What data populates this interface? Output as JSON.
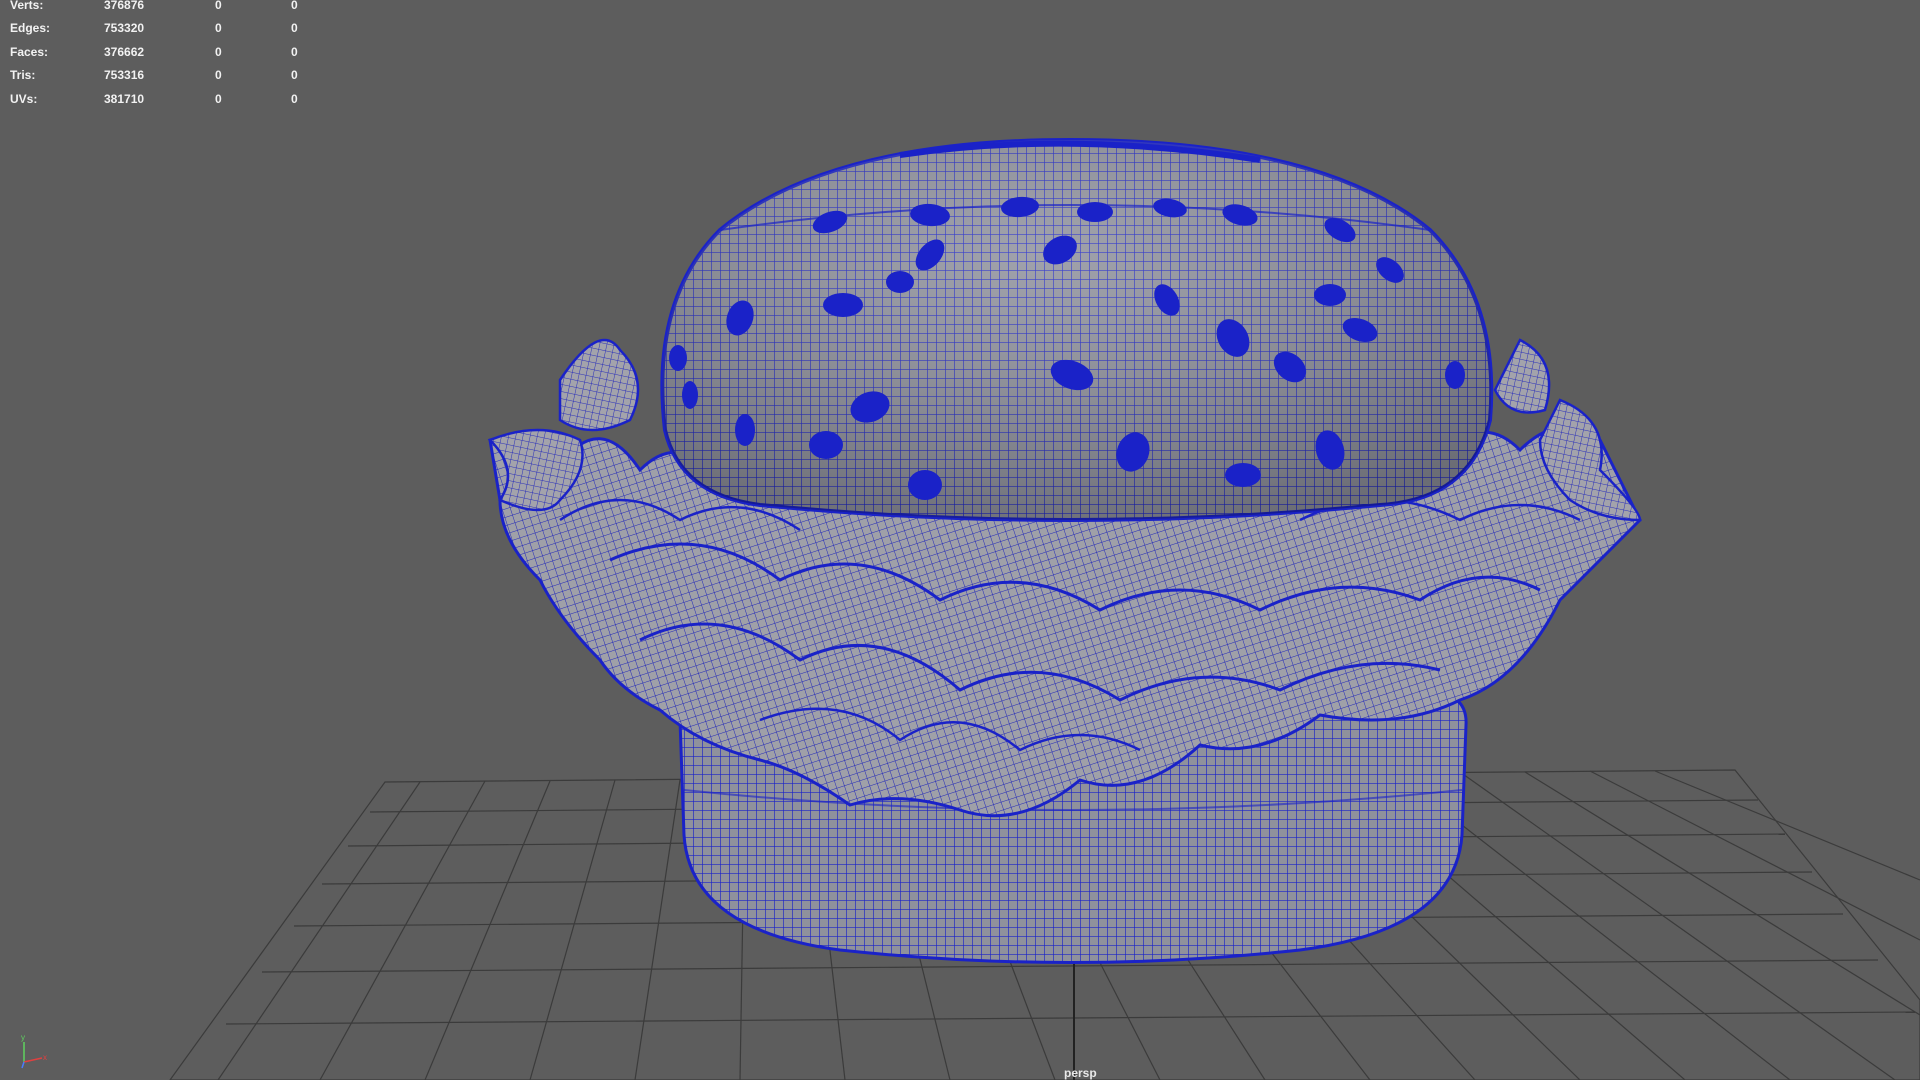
{
  "viewport": {
    "camera_label": "persp",
    "background_color": "#5d5d5d",
    "wireframe_color": "#1a22c8",
    "grid_color": "#3a3a3a"
  },
  "heads_up_display": {
    "rows": [
      {
        "label": "Verts:",
        "total": "376876",
        "selected": "0",
        "component": "0"
      },
      {
        "label": "Edges:",
        "total": "753320",
        "selected": "0",
        "component": "0"
      },
      {
        "label": "Faces:",
        "total": "376662",
        "selected": "0",
        "component": "0"
      },
      {
        "label": "Tris:",
        "total": "753316",
        "selected": "0",
        "component": "0"
      },
      {
        "label": "UVs:",
        "total": "381710",
        "selected": "0",
        "component": "0"
      }
    ]
  },
  "axis_gizmo": {
    "icon": "xyz-axis-icon",
    "y_label": "y",
    "x_label": "x",
    "y_color": "#5fd35f",
    "x_color": "#e04040",
    "z_color": "#4a7bff"
  }
}
